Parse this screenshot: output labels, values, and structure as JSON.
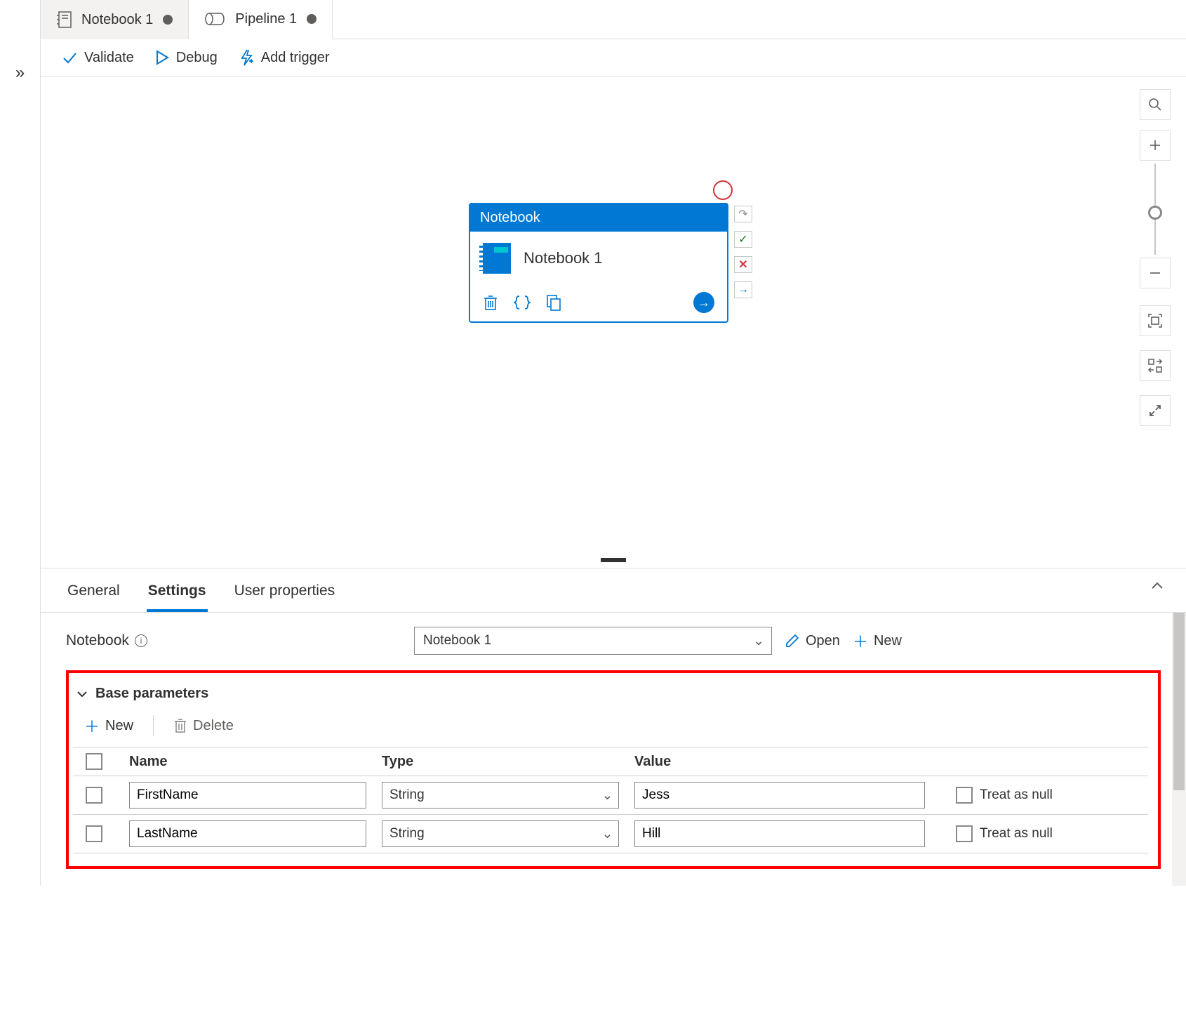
{
  "tabs": [
    {
      "label": "Notebook 1",
      "active": false
    },
    {
      "label": "Pipeline 1",
      "active": true
    }
  ],
  "toolbar": {
    "validate": "Validate",
    "debug": "Debug",
    "addTrigger": "Add trigger"
  },
  "activity": {
    "type": "Notebook",
    "name": "Notebook 1"
  },
  "panel": {
    "tabs": {
      "general": "General",
      "settings": "Settings",
      "userProps": "User properties"
    },
    "notebookLabel": "Notebook",
    "notebookSelected": "Notebook 1",
    "openLabel": "Open",
    "newLabel": "New",
    "baseParamsTitle": "Base parameters",
    "paramToolbar": {
      "new": "New",
      "delete": "Delete"
    },
    "columns": {
      "name": "Name",
      "type": "Type",
      "value": "Value"
    },
    "treatAsNull": "Treat as null",
    "rows": [
      {
        "name": "FirstName",
        "type": "String",
        "value": "Jess"
      },
      {
        "name": "LastName",
        "type": "String",
        "value": "Hill"
      }
    ]
  }
}
